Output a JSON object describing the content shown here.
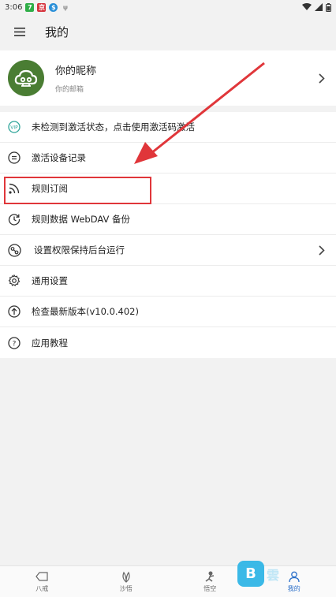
{
  "status_bar": {
    "time": "3:06",
    "notifications": [
      {
        "icon": "green-app-icon",
        "glyph": "7",
        "color": "#2fae47"
      },
      {
        "icon": "red-app-icon",
        "glyph": "京",
        "color": "#d6323c"
      },
      {
        "icon": "blue-app-icon",
        "glyph": "$",
        "color": "#2a8fd8"
      },
      {
        "icon": "misc-app-icon",
        "glyph": "ψ",
        "color": "#9a9a9a"
      }
    ]
  },
  "app_bar": {
    "title": "我的"
  },
  "profile": {
    "nickname": "你的昵称",
    "email": "你的邮箱"
  },
  "menu": [
    {
      "icon": "activation-key-icon",
      "label": "未检测到激活状态，点击使用激活码激活",
      "chevron": false
    },
    {
      "icon": "device-record-icon",
      "label": "激活设备记录",
      "chevron": false
    },
    {
      "icon": "rss-feed-icon",
      "label": "规则订阅",
      "chevron": false
    },
    {
      "icon": "backup-clock-icon",
      "label": "规则数据 WebDAV 备份",
      "chevron": false
    },
    {
      "icon": "background-run-icon",
      "label": "设置权限保持后台运行",
      "chevron": true
    },
    {
      "icon": "gear-icon",
      "label": "通用设置",
      "chevron": false
    },
    {
      "icon": "upload-arrow-icon",
      "label": "检查最新版本(v10.0.402)",
      "chevron": false
    },
    {
      "icon": "help-icon",
      "label": "应用教程",
      "chevron": false
    }
  ],
  "bottom_nav": [
    {
      "icon": "tag-icon",
      "label": "八戒",
      "active": false
    },
    {
      "icon": "leaf-icon",
      "label": "沙悟",
      "active": false
    },
    {
      "icon": "monkey-icon",
      "label": "悟空",
      "active": false
    },
    {
      "icon": "person-icon",
      "label": "我的",
      "active": true
    }
  ],
  "watermark": {
    "logo": "B",
    "text": "雲"
  },
  "colors": {
    "accent": "#2b6fc9",
    "annotation": "#e0363a",
    "avatar": "#4a7d33"
  }
}
